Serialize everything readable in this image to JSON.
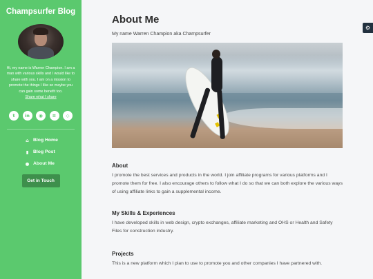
{
  "sidebar": {
    "blog_name": "Champsurfer Blog",
    "bio": "Hi, my name is Warren Champion. I am a man with various skills and I would like to share with you. I am on a mission to promote the things I like so maybe you can gain some benefit too.",
    "share_link": "Share what I share",
    "socials": [
      {
        "icon": "twitter-icon",
        "glyph": "t"
      },
      {
        "icon": "linkedin-icon",
        "glyph": "in"
      },
      {
        "icon": "github-icon",
        "glyph": "◉"
      },
      {
        "icon": "stack-overflow-icon",
        "glyph": "≡"
      },
      {
        "icon": "codepen-icon",
        "glyph": "◇"
      }
    ],
    "nav": [
      {
        "label": "Blog Home",
        "icon": "home-icon",
        "glyph": "⌂",
        "active": false
      },
      {
        "label": "Blog Post",
        "icon": "bookmark-icon",
        "glyph": "▮",
        "active": false
      },
      {
        "label": "About Me",
        "icon": "user-icon",
        "glyph": "●",
        "active": true
      }
    ],
    "cta": "Get in Touch"
  },
  "main": {
    "title": "About Me",
    "subtitle": "My name Warren Champion aka Champsurfer",
    "sections": [
      {
        "title": "About",
        "text": "I promote the best services and products in the world. I join affiliate programs for various platforms and I promote them for free. I also encourage others to follow what I do so that we can both explore the various ways of using affiliate links to gain a supplemental income."
      },
      {
        "title": "My Skills & Experiences",
        "text": "I have developed skills in web design, crypto exchanges, affiliate marketing and OHS or Health and Safety Files for construction industry."
      },
      {
        "title": "Projects",
        "text": "This is a new platform which I plan to use to promote you and other companies I have partnered with."
      }
    ]
  },
  "theme": {
    "accent": "#5bc96e",
    "cta_bg": "#3e8f4c",
    "gear_bg": "#22313f"
  },
  "settings_icon": "gear-icon"
}
